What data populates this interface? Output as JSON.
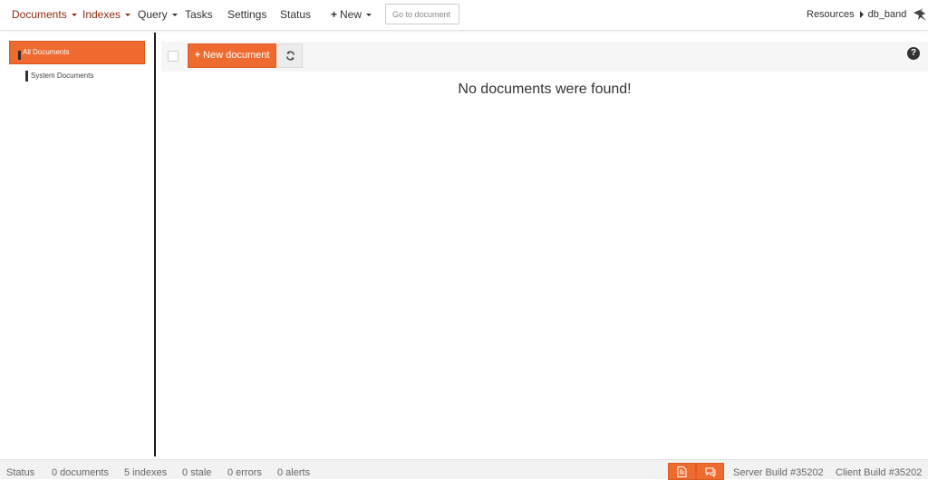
{
  "navbar": {
    "documents": "Documents",
    "indexes": "Indexes",
    "query": "Query",
    "tasks": "Tasks",
    "settings": "Settings",
    "status": "Status",
    "new": "New",
    "goto_placeholder": "Go to document",
    "resources": "Resources",
    "database": "db_band"
  },
  "sidebar": {
    "all_documents": "All Documents",
    "system_documents": "System Documents"
  },
  "toolbar": {
    "new_document": "New document",
    "help": "?"
  },
  "main": {
    "empty_message": "No documents were found!"
  },
  "footer": {
    "status": "Status",
    "documents": "0 documents",
    "indexes": "5 indexes",
    "stale": "0 stale",
    "errors": "0 errors",
    "alerts": "0 alerts",
    "server_build": "Server Build #35202",
    "client_build": "Client Build #35202"
  },
  "colors": {
    "accent": "#ee6a2f",
    "active_nav": "#8a2c12"
  }
}
